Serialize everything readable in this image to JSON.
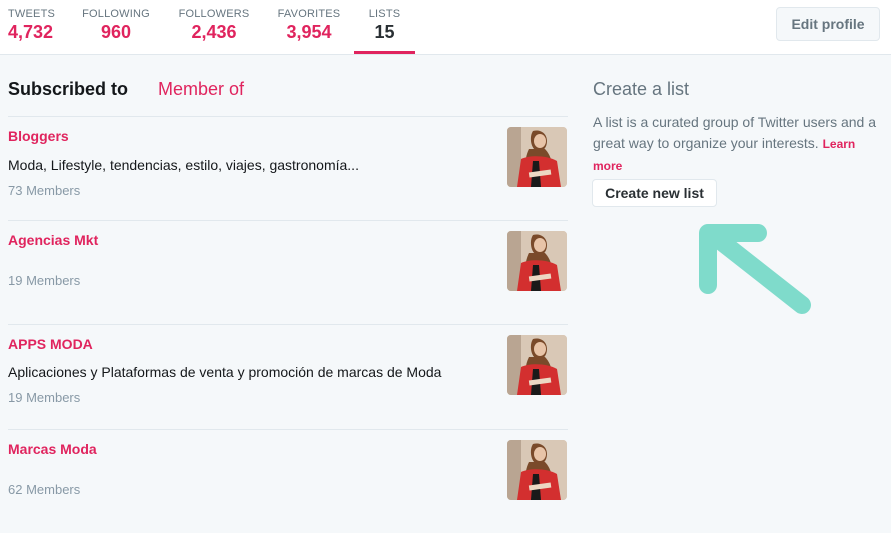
{
  "stats": [
    {
      "label": "TWEETS",
      "value": "4,732"
    },
    {
      "label": "FOLLOWING",
      "value": "960"
    },
    {
      "label": "FOLLOWERS",
      "value": "2,436"
    },
    {
      "label": "FAVORITES",
      "value": "3,954"
    },
    {
      "label": "LISTS",
      "value": "15"
    }
  ],
  "edit_profile_label": "Edit profile",
  "tabs": {
    "subscribed": "Subscribed to",
    "member": "Member of"
  },
  "lists": [
    {
      "name": "Bloggers",
      "description": "Moda, Lifestyle, tendencias, estilo, viajes, gastronomía...",
      "members": "73 Members"
    },
    {
      "name": "Agencias Mkt",
      "description": "",
      "members": "19 Members"
    },
    {
      "name": "APPS MODA",
      "description": "Aplicaciones y Plataformas de venta y promoción de marcas de Moda",
      "members": "19 Members"
    },
    {
      "name": "Marcas Moda",
      "description": "",
      "members": "62 Members"
    }
  ],
  "create": {
    "title": "Create a list",
    "text": "A list is a curated group of Twitter users and a great way to organize your interests.",
    "learn_more": "Learn more",
    "button": "Create new list"
  },
  "colors": {
    "accent": "#e0245e",
    "arrow": "#7fdbcb",
    "background": "#f5f8fa"
  },
  "icons": {
    "annotation": "arrow-icon",
    "avatar": "avatar"
  }
}
